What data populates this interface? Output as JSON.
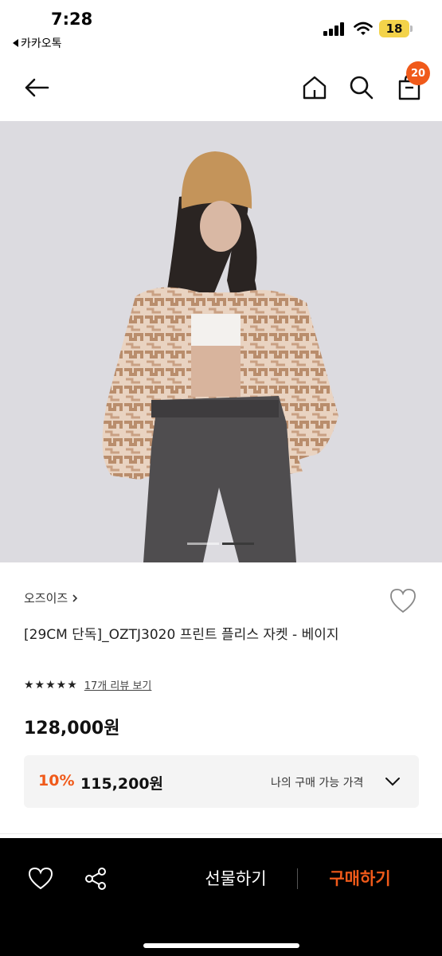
{
  "status_bar": {
    "time": "7:28",
    "battery": "18",
    "back_app": "카카오톡",
    "battery_color": "#f3d34a"
  },
  "nav": {
    "back_icon": "back-arrow-icon",
    "home_icon": "home-icon",
    "search_icon": "search-icon",
    "cart_icon": "cart-icon",
    "cart_count": "20",
    "accent_color": "#f05a1a"
  },
  "gallery": {
    "total_images": 2,
    "active_index": 1
  },
  "product": {
    "brand": "오즈이즈",
    "title": "[29CM 단독]_OZTJ3020 프린트 플리스 자켓 - 베이지",
    "rating_stars": "★★★★★",
    "review_link": "17개 리뷰 보기",
    "price": "128,000원"
  },
  "member_price": {
    "discount": "10%",
    "price": "115,200원",
    "label": "나의 구매 가능 가격"
  },
  "bottom_bar": {
    "like_icon": "heart-icon",
    "share_icon": "share-icon",
    "gift_label": "선물하기",
    "buy_label": "구매하기"
  }
}
